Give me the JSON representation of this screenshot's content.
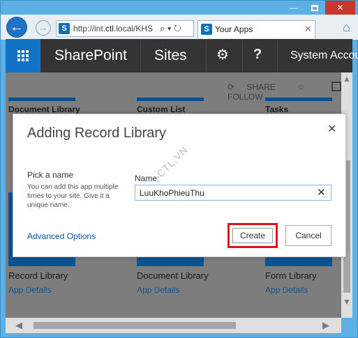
{
  "window": {
    "minimize_icon": "minimize-icon",
    "maximize_icon": "maximize-icon",
    "close_icon": "close-icon",
    "close_glyph": "✕",
    "minimize_glyph": "—"
  },
  "browser": {
    "back_glyph": "←",
    "forward_glyph": "→",
    "address_prefix": "http://int.",
    "address_domain": "ctl",
    "address_suffix": ".local/KHS",
    "address_icons": "⌕ ▾ ↻",
    "tab_title": "Your Apps",
    "tab_close": "✕",
    "home_glyph": "⌂"
  },
  "suitebar": {
    "brand": "SharePoint",
    "sites": "Sites",
    "gear_glyph": "⚙",
    "help_glyph": "?",
    "user": "System Accou"
  },
  "page": {
    "share": "SHARE",
    "follow": "FOLLOW",
    "share_glyph": "⟳",
    "follow_glyph": "☆",
    "top_tiles": [
      "Document Library",
      "Custom List",
      "Tasks"
    ],
    "bottom_tiles": [
      "Record Library",
      "Document Library",
      "Form Library"
    ],
    "details_label": "App Details"
  },
  "dialog": {
    "title": "Adding Record Library",
    "close_glyph": "✕",
    "pick_title": "Pick a name",
    "pick_desc": "You can add this app multiple times to your site. Give it a unique name.",
    "name_label": "Name:",
    "name_value": "LuuKhoPhieuThu",
    "clear_glyph": "✕",
    "advanced_options": "Advanced Options",
    "create": "Create",
    "cancel": "Cancel",
    "watermark": "CTL.VN"
  },
  "colors": {
    "accent": "#0f72c5",
    "suitebar": "#343434",
    "highlight": "#d9141c",
    "link": "#0b5494"
  }
}
